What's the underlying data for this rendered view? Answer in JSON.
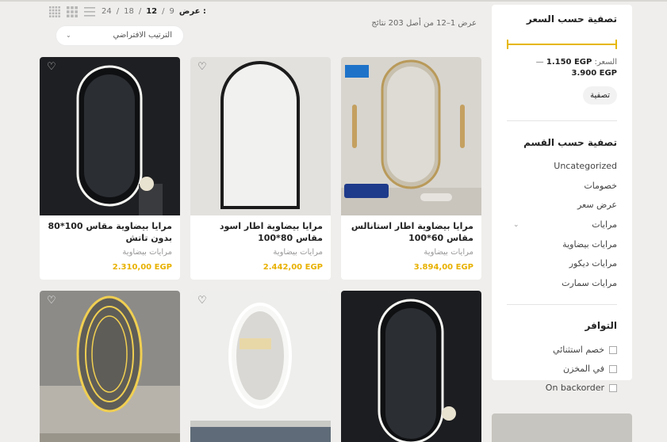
{
  "toolbar": {
    "show_label": "عرض :",
    "per_page": [
      "9",
      "12",
      "18",
      "24"
    ],
    "selected_per_page": "12",
    "results_text": "عرض 1–12 من أصل 203 نتائج",
    "sort_value": "الترتيب الافتراضي",
    "view_icons": [
      "list-view-icon",
      "grid-3-icon",
      "grid-4-icon"
    ]
  },
  "sidebar": {
    "price_title": "تصفية حسب السعر",
    "price_label": "السعر:",
    "price_min": "1.150 EGP",
    "price_max": "3.900 EGP",
    "price_filter": {
      "min_fraction": 0.0,
      "max_fraction": 1.0
    },
    "filter_button": "تصفية",
    "category_title": "تصفية حسب القسم",
    "categories": [
      "Uncategorized",
      "خصومات",
      "عرض سعر",
      "مرايات",
      "مرايات بيضاوية",
      "مرايات ديكور",
      "مرايات سمارت"
    ],
    "availability_title": "التوافر",
    "availability": [
      "خصم استثنائي",
      "في المخزن",
      "On backorder"
    ]
  },
  "products": [
    {
      "name": "مرايا بيضاوية اطار استانالس مقاس 60*100",
      "category": "مرايات بيضاوية",
      "price": "3.894,00 EGP"
    },
    {
      "name": "مرايا بيضاوية اطار اسود مقاس 80*100",
      "category": "مرايات بيضاوية",
      "price": "2.442,00 EGP"
    },
    {
      "name": "مرايا بيضاوية مقاس 100*80 بدون تاتش",
      "category": "مرايات بيضاوية",
      "price": "2.310,00 EGP"
    },
    {
      "name": "",
      "category": "",
      "price": ""
    },
    {
      "name": "",
      "category": "",
      "price": ""
    },
    {
      "name": "",
      "category": "",
      "price": ""
    }
  ],
  "colors": {
    "accent": "#e8b100",
    "background": "#efeeec",
    "card": "#ffffff"
  }
}
